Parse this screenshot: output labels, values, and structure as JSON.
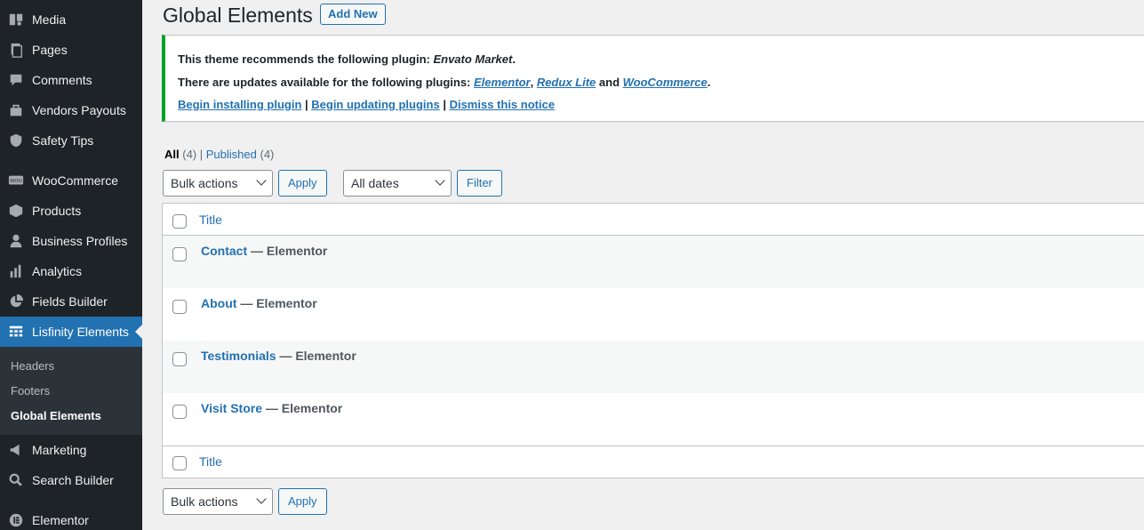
{
  "sidebar": {
    "items": [
      {
        "label": "Media",
        "icon": "media-icon"
      },
      {
        "label": "Pages",
        "icon": "pages-icon"
      },
      {
        "label": "Comments",
        "icon": "comments-icon"
      },
      {
        "label": "Vendors Payouts",
        "icon": "payouts-icon"
      },
      {
        "label": "Safety Tips",
        "icon": "shield-icon"
      },
      {
        "label": "WooCommerce",
        "icon": "woo-icon"
      },
      {
        "label": "Products",
        "icon": "box-icon"
      },
      {
        "label": "Business Profiles",
        "icon": "user-icon"
      },
      {
        "label": "Analytics",
        "icon": "bar-chart-icon"
      },
      {
        "label": "Fields Builder",
        "icon": "pie-chart-icon"
      },
      {
        "label": "Lisfinity Elements",
        "icon": "table-icon"
      },
      {
        "label": "Marketing",
        "icon": "megaphone-icon"
      },
      {
        "label": "Search Builder",
        "icon": "search-icon"
      },
      {
        "label": "Elementor",
        "icon": "elementor-icon"
      }
    ],
    "submenu": [
      "Headers",
      "Footers",
      "Global Elements"
    ]
  },
  "header": {
    "title": "Global Elements",
    "add_new": "Add New"
  },
  "notice": {
    "line1_prefix": "This theme recommends the following plugin: ",
    "line1_plugin": "Envato Market",
    "line1_suffix": ".",
    "line2_prefix": "There are updates available for the following plugins: ",
    "plugin_a": "Elementor",
    "sep1": ", ",
    "plugin_b": "Redux Lite",
    "sep2": " and ",
    "plugin_c": "WooCommerce",
    "line2_suffix": ".",
    "link_install": "Begin installing plugin",
    "pipe": " | ",
    "link_update": "Begin updating plugins",
    "link_dismiss": "Dismiss this notice"
  },
  "views": {
    "all_label": "All",
    "all_count": "(4)",
    "sep": " | ",
    "published_label": "Published",
    "published_count": "(4)"
  },
  "toolbar": {
    "bulk_actions": "Bulk actions",
    "apply": "Apply",
    "dates": "All dates",
    "filter": "Filter"
  },
  "table": {
    "column_title": "Title",
    "rows": [
      {
        "name": "Contact",
        "state": " — Elementor"
      },
      {
        "name": "About",
        "state": " — Elementor"
      },
      {
        "name": "Testimonials",
        "state": " — Elementor"
      },
      {
        "name": "Visit Store",
        "state": " — Elementor"
      }
    ]
  },
  "colors": {
    "sidebar_bg": "#1d2327",
    "accent": "#2271b1",
    "notice_success": "#00a32a"
  }
}
